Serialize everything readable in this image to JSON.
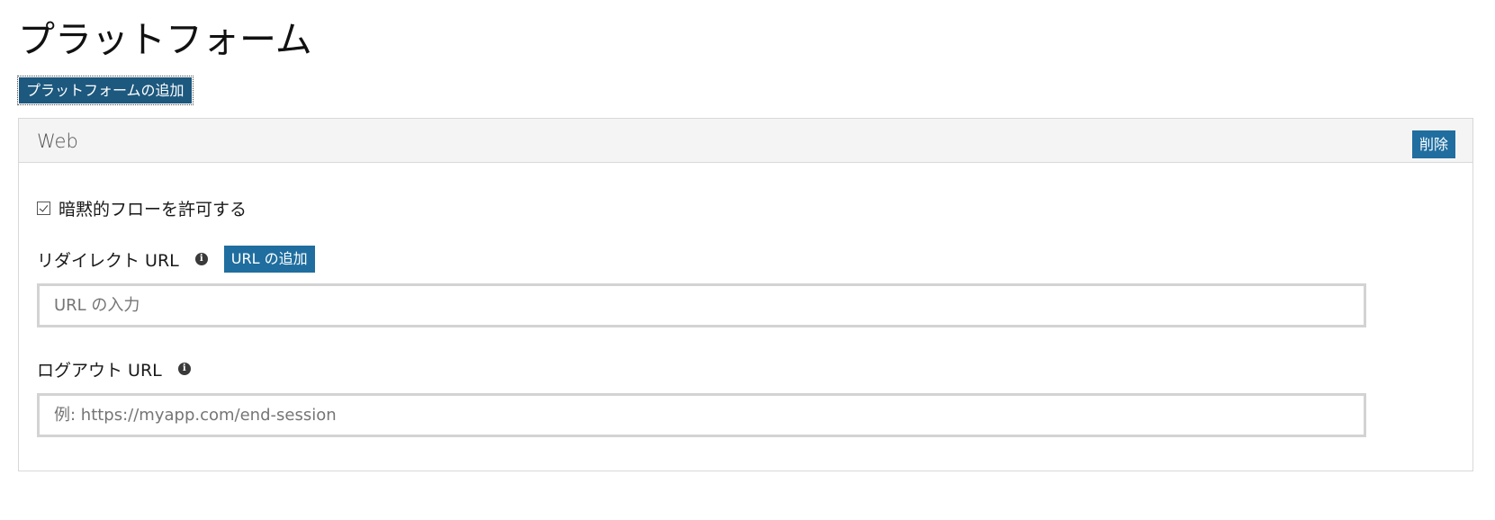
{
  "page": {
    "title": "プラットフォーム",
    "add_platform_label": "プラットフォームの追加"
  },
  "platform": {
    "name": "Web",
    "delete_label": "削除",
    "implicit_flow": {
      "label": "暗黙的フローを許可する",
      "checked": true
    },
    "redirect_url": {
      "label": "リダイレクト URL",
      "info_icon": "info-icon",
      "add_label": "URL の追加",
      "value": "",
      "placeholder": "URL の入力"
    },
    "logout_url": {
      "label": "ログアウト URL",
      "info_icon": "info-icon",
      "value": "",
      "placeholder": "例: https://myapp.com/end-session"
    }
  },
  "colors": {
    "primary_button": "#1d587e",
    "secondary_button": "#1f6e9f",
    "panel_header_bg": "#f4f4f4",
    "border": "#d8d8d8",
    "input_border": "#d3d3d3"
  }
}
